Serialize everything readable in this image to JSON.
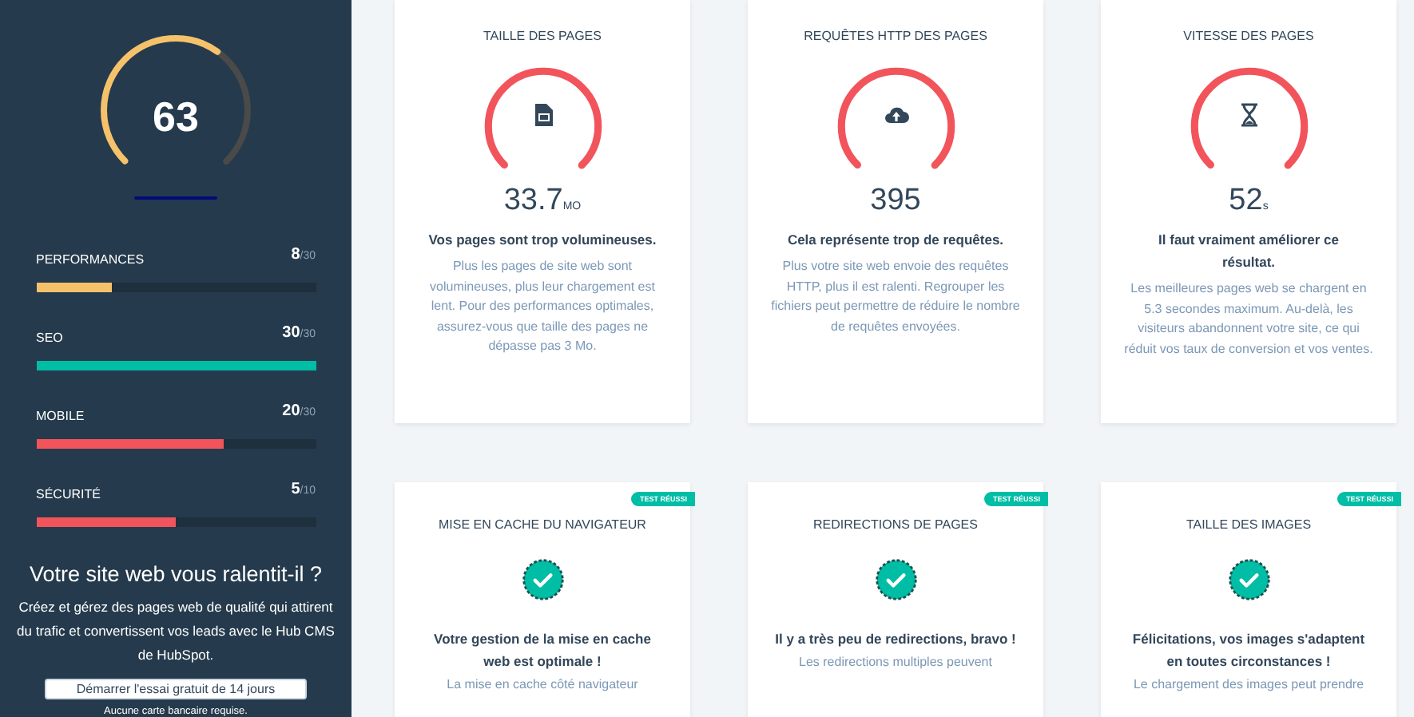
{
  "sidebar": {
    "score": {
      "value": "63"
    },
    "categories": [
      {
        "label": "PERFORMANCES",
        "score": "8",
        "max": "/30",
        "level": 0.27,
        "color": "#f5c26b"
      },
      {
        "label": "SEO",
        "score": "30",
        "max": "/30",
        "level": 1,
        "color": "#00bda5"
      },
      {
        "label": "MOBILE",
        "score": "20",
        "max": "/30",
        "level": 0.67,
        "color": "#f2545b"
      },
      {
        "label": "SÉCURITÉ",
        "score": "5",
        "max": "/10",
        "level": 0.5,
        "color": "#f2545b"
      }
    ],
    "promo": {
      "title": "Votre site web vous ralentit-il ?",
      "text": "Créez et gérez des pages web de qualité qui attirent du trafic et convertissent vos leads avec le Hub CMS de HubSpot.",
      "button": "Démarrer l'essai gratuit de 14 jours",
      "note": "Aucune carte bancaire requise."
    }
  },
  "cards": [
    {
      "kind": "gauge",
      "title": "TAILLE DES PAGES",
      "value": "33.7",
      "unit": "MO",
      "heading": "Vos pages sont trop volumineuses.",
      "text": "Plus les pages de site web sont volumineuses, plus leur chargement est lent. Pour des performances optimales, assurez-vous que taille des pages ne dépasse pas 3 Mo."
    },
    {
      "kind": "gauge",
      "title": "REQUÊTES HTTP DES PAGES",
      "value": "395",
      "heading": "Cela représente trop de requêtes.",
      "text": "Plus votre site web envoie des requêtes HTTP, plus il est ralenti. Regrouper les fichiers peut permettre de réduire le nombre de requêtes envoyées."
    },
    {
      "kind": "gauge",
      "title": "VITESSE DES PAGES",
      "value": "52",
      "unit": "s",
      "heading": "Il faut vraiment améliorer ce résultat.",
      "text": "Les meilleures pages web se chargent en 5.3 secondes maximum. Au-delà, les visiteurs abandonnent votre site, ce qui réduit vos taux de conversion et vos ventes."
    },
    {
      "kind": "passed",
      "badge": "TEST RÉUSSI",
      "title": "MISE EN CACHE DU NAVIGATEUR",
      "heading": "Votre gestion de la mise en cache web est optimale !",
      "text": "La mise en cache côté navigateur"
    },
    {
      "kind": "passed",
      "badge": "TEST RÉUSSI",
      "title": "REDIRECTIONS DE PAGES",
      "heading": "Il y a très peu de redirections, bravo !",
      "text": "Les redirections multiples peuvent"
    },
    {
      "kind": "passed",
      "badge": "TEST RÉUSSI",
      "title": "TAILLE DES IMAGES",
      "heading": "Félicitations, vos images s'adaptent en toutes circonstances !",
      "text": "Le chargement des images peut prendre"
    }
  ]
}
